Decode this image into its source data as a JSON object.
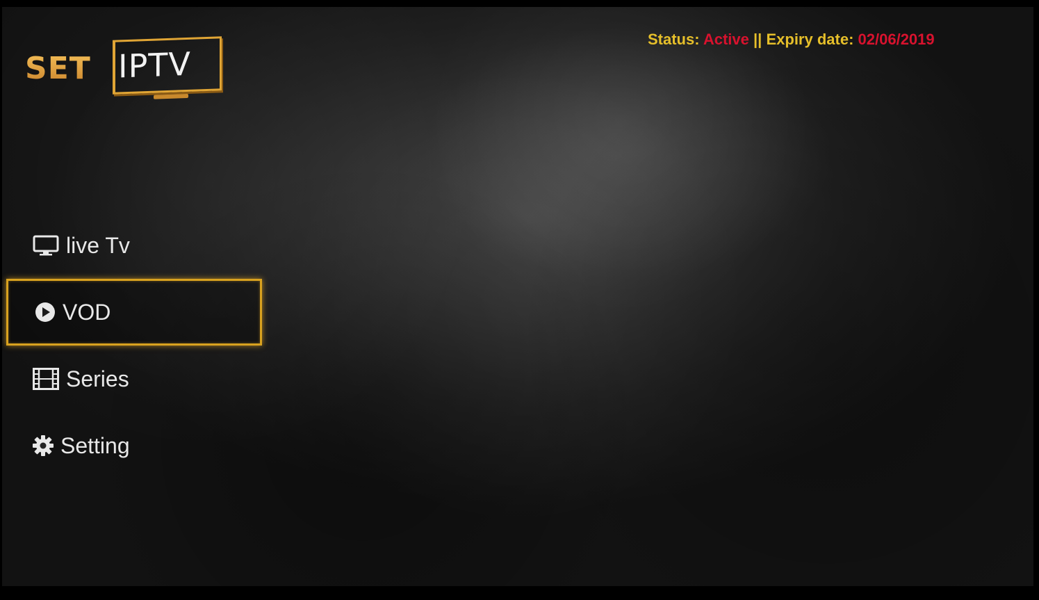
{
  "logo": {
    "brand_left": "SET",
    "brand_right": "IPTV"
  },
  "status": {
    "status_label": "Status:",
    "status_value": "Active",
    "separator": "||",
    "expiry_label": "Expiry date:",
    "expiry_value": "02/06/2019"
  },
  "menu": {
    "items": [
      {
        "label": "live Tv",
        "icon": "tv-monitor-icon"
      },
      {
        "label": "VOD",
        "icon": "play-circle-icon",
        "selected": true
      },
      {
        "label": "Series",
        "icon": "film-strip-icon"
      },
      {
        "label": "Setting",
        "icon": "gear-icon"
      }
    ]
  },
  "colors": {
    "accent_gold": "#e6bf2a",
    "status_red": "#d8122e",
    "selection_border": "#d9a21f",
    "menu_text": "#e8e8e8"
  }
}
